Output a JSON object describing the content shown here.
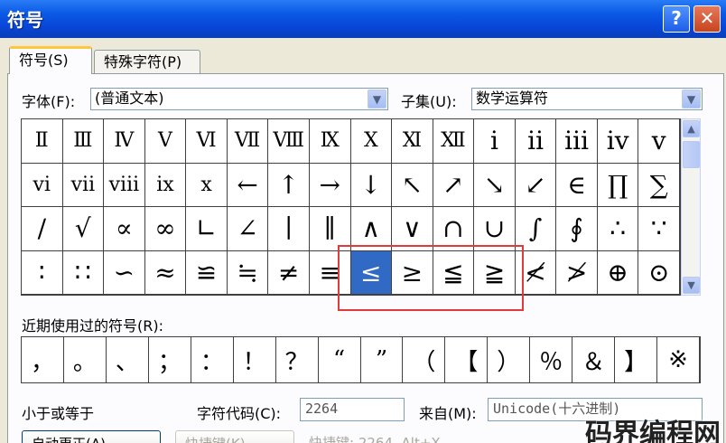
{
  "window": {
    "title": "符号",
    "help_label": "?",
    "close_label": "✕"
  },
  "tabs": [
    {
      "label": "符号(S)"
    },
    {
      "label": "特殊字符(P)"
    }
  ],
  "font": {
    "label": "字体(F):",
    "value": "(普通文本)"
  },
  "subset": {
    "label": "子集(U):",
    "value": "数学运算符"
  },
  "symbols": [
    [
      "Ⅱ",
      "Ⅲ",
      "Ⅳ",
      "Ⅴ",
      "Ⅵ",
      "Ⅶ",
      "Ⅷ",
      "Ⅸ",
      "Ⅹ",
      "Ⅺ",
      "Ⅻ",
      "ⅰ",
      "ⅱ",
      "ⅲ",
      "ⅳ",
      "ⅴ"
    ],
    [
      "ⅵ",
      "ⅶ",
      "ⅷ",
      "ⅸ",
      "ⅹ",
      "←",
      "↑",
      "→",
      "↓",
      "↖",
      "↗",
      "↘",
      "↙",
      "∈",
      "∏",
      "∑"
    ],
    [
      "∕",
      "√",
      "∝",
      "∞",
      "∟",
      "∠",
      "∣",
      "∥",
      "∧",
      "∨",
      "∩",
      "∪",
      "∫",
      "∮",
      "∴",
      "∵"
    ],
    [
      "∶",
      "∷",
      "∽",
      "≈",
      "≌",
      "≒",
      "≠",
      "≡",
      "≤",
      "≥",
      "≦",
      "≧",
      "≮",
      "≯",
      "⊕",
      "⊙"
    ]
  ],
  "selected_symbol": "≤",
  "recent": {
    "label": "近期使用过的符号(R):",
    "items": [
      "，",
      "。",
      "、",
      "；",
      "：",
      "！",
      "？",
      "“",
      "”",
      "（",
      "【",
      "）",
      "％",
      "＆",
      "】",
      "※"
    ]
  },
  "char_name": "小于或等于",
  "char_code": {
    "label": "字符代码(C):",
    "value": "2264"
  },
  "from": {
    "label": "来自(M):",
    "value": "Unicode(十六进制)"
  },
  "buttons": {
    "autocorrect": "自动更正(A)...",
    "shortcut_key": "快捷键(K)..."
  },
  "shortcut_text": "快捷键: 2264, Alt+X",
  "watermark": "码界编程网"
}
